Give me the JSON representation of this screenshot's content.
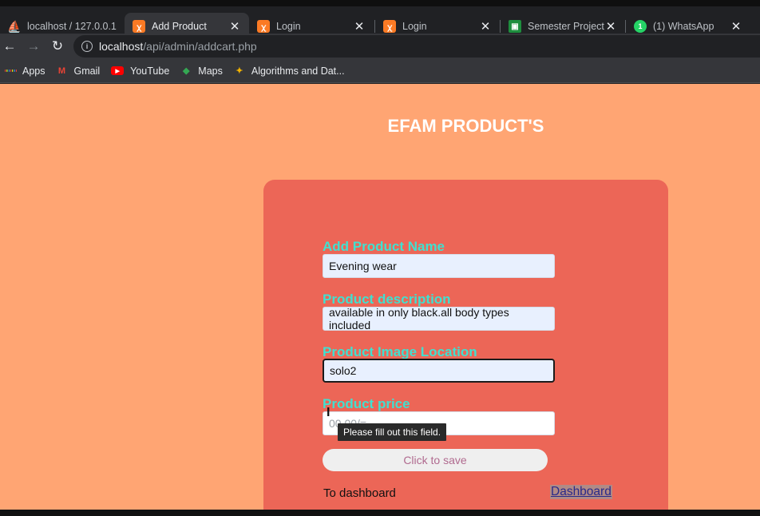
{
  "browser": {
    "tabs": [
      {
        "title": "localhost / 127.0.0.1",
        "icon": "phpmyadmin-icon",
        "active": false
      },
      {
        "title": "Add Product",
        "icon": "xampp-icon",
        "active": true
      },
      {
        "title": "Login",
        "icon": "xampp-icon",
        "active": false
      },
      {
        "title": "Login",
        "icon": "xampp-icon",
        "active": false
      },
      {
        "title": "Semester Project",
        "icon": "classroom-icon",
        "active": false
      },
      {
        "title": "(1) WhatsApp",
        "icon": "whatsapp-icon",
        "active": false
      }
    ],
    "whatsapp_badge": "1",
    "url_host": "localhost",
    "url_path": "/api/admin/addcart.php",
    "bookmarks": [
      {
        "label": "Apps",
        "icon": "apps-grid-icon"
      },
      {
        "label": "Gmail",
        "icon": "gmail-icon"
      },
      {
        "label": "YouTube",
        "icon": "youtube-icon"
      },
      {
        "label": "Maps",
        "icon": "maps-icon"
      },
      {
        "label": "Algorithms and Dat...",
        "icon": "algorithms-icon"
      }
    ]
  },
  "page": {
    "title": "EFAM PRODUCT'S",
    "background_color": "#ffa573",
    "card_color": "#ec6657",
    "label_color": "#40e0d0",
    "form": {
      "fields": [
        {
          "label": "Add Product Name",
          "value": "Evening wear",
          "placeholder": ""
        },
        {
          "label": "Product description",
          "value": "available in  only black.all body types included",
          "placeholder": ""
        },
        {
          "label": "Product Image Location",
          "value": "solo2",
          "placeholder": ""
        },
        {
          "label": "Product price",
          "value": "",
          "placeholder": "00.00/="
        }
      ],
      "save_label": "Click to save"
    },
    "footer": {
      "text": "To dashboard",
      "link_label": "Dashboard"
    },
    "validation_tooltip": "Please fill out this field."
  }
}
